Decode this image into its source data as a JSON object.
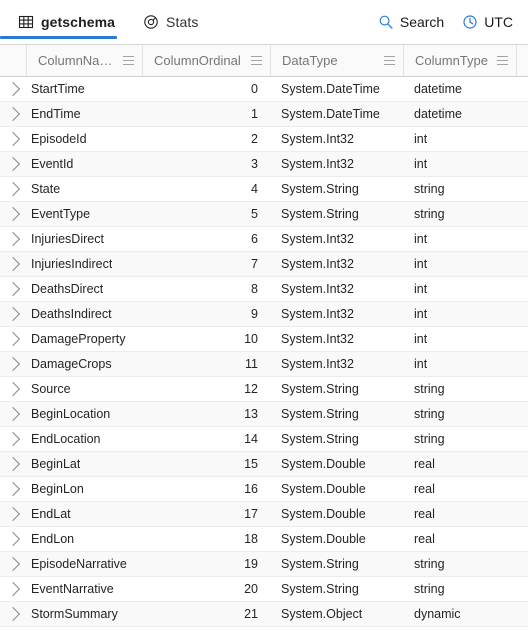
{
  "theme": {
    "accent": "#2a7ad2",
    "header_text": "#77757a",
    "row_alt_bg": "#f9f9f9"
  },
  "tabbar": {
    "tabs": [
      {
        "label": "getschema",
        "icon": "table-grid-icon",
        "active": true
      },
      {
        "label": "Stats",
        "icon": "donut-chart-icon",
        "active": false
      }
    ],
    "actions": [
      {
        "label": "Search",
        "icon": "search-icon"
      },
      {
        "label": "UTC",
        "icon": "clock-icon"
      }
    ]
  },
  "grid": {
    "columns": [
      {
        "key": "ColumnName",
        "label": "ColumnName",
        "menu_icon": "column-menu-icon"
      },
      {
        "key": "ColumnOrdinal",
        "label": "ColumnOrdinal",
        "menu_icon": "column-menu-icon"
      },
      {
        "key": "DataType",
        "label": "DataType",
        "menu_icon": "column-menu-icon"
      },
      {
        "key": "ColumnType",
        "label": "ColumnType",
        "menu_icon": "column-menu-icon"
      }
    ],
    "rows": [
      {
        "ColumnName": "StartTime",
        "ColumnOrdinal": "0",
        "DataType": "System.DateTime",
        "ColumnType": "datetime"
      },
      {
        "ColumnName": "EndTime",
        "ColumnOrdinal": "1",
        "DataType": "System.DateTime",
        "ColumnType": "datetime"
      },
      {
        "ColumnName": "EpisodeId",
        "ColumnOrdinal": "2",
        "DataType": "System.Int32",
        "ColumnType": "int"
      },
      {
        "ColumnName": "EventId",
        "ColumnOrdinal": "3",
        "DataType": "System.Int32",
        "ColumnType": "int"
      },
      {
        "ColumnName": "State",
        "ColumnOrdinal": "4",
        "DataType": "System.String",
        "ColumnType": "string"
      },
      {
        "ColumnName": "EventType",
        "ColumnOrdinal": "5",
        "DataType": "System.String",
        "ColumnType": "string"
      },
      {
        "ColumnName": "InjuriesDirect",
        "ColumnOrdinal": "6",
        "DataType": "System.Int32",
        "ColumnType": "int"
      },
      {
        "ColumnName": "InjuriesIndirect",
        "ColumnOrdinal": "7",
        "DataType": "System.Int32",
        "ColumnType": "int"
      },
      {
        "ColumnName": "DeathsDirect",
        "ColumnOrdinal": "8",
        "DataType": "System.Int32",
        "ColumnType": "int"
      },
      {
        "ColumnName": "DeathsIndirect",
        "ColumnOrdinal": "9",
        "DataType": "System.Int32",
        "ColumnType": "int"
      },
      {
        "ColumnName": "DamageProperty",
        "ColumnOrdinal": "10",
        "DataType": "System.Int32",
        "ColumnType": "int"
      },
      {
        "ColumnName": "DamageCrops",
        "ColumnOrdinal": "11",
        "DataType": "System.Int32",
        "ColumnType": "int"
      },
      {
        "ColumnName": "Source",
        "ColumnOrdinal": "12",
        "DataType": "System.String",
        "ColumnType": "string"
      },
      {
        "ColumnName": "BeginLocation",
        "ColumnOrdinal": "13",
        "DataType": "System.String",
        "ColumnType": "string"
      },
      {
        "ColumnName": "EndLocation",
        "ColumnOrdinal": "14",
        "DataType": "System.String",
        "ColumnType": "string"
      },
      {
        "ColumnName": "BeginLat",
        "ColumnOrdinal": "15",
        "DataType": "System.Double",
        "ColumnType": "real"
      },
      {
        "ColumnName": "BeginLon",
        "ColumnOrdinal": "16",
        "DataType": "System.Double",
        "ColumnType": "real"
      },
      {
        "ColumnName": "EndLat",
        "ColumnOrdinal": "17",
        "DataType": "System.Double",
        "ColumnType": "real"
      },
      {
        "ColumnName": "EndLon",
        "ColumnOrdinal": "18",
        "DataType": "System.Double",
        "ColumnType": "real"
      },
      {
        "ColumnName": "EpisodeNarrative",
        "ColumnOrdinal": "19",
        "DataType": "System.String",
        "ColumnType": "string"
      },
      {
        "ColumnName": "EventNarrative",
        "ColumnOrdinal": "20",
        "DataType": "System.String",
        "ColumnType": "string"
      },
      {
        "ColumnName": "StormSummary",
        "ColumnOrdinal": "21",
        "DataType": "System.Object",
        "ColumnType": "dynamic"
      }
    ]
  }
}
